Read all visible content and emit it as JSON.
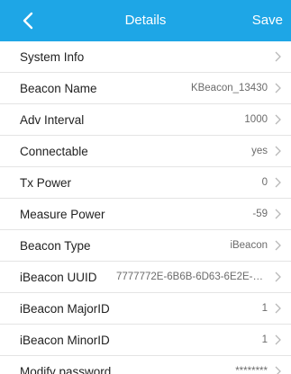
{
  "header": {
    "title": "Details",
    "back_icon": "chevron-left-icon",
    "save_label": "Save",
    "background": "#1ea6e6"
  },
  "rows": [
    {
      "label": "System Info",
      "value": ""
    },
    {
      "label": "Beacon Name",
      "value": "KBeacon_13430"
    },
    {
      "label": "Adv Interval",
      "value": "1000"
    },
    {
      "label": "Connectable",
      "value": "yes"
    },
    {
      "label": "Tx Power",
      "value": "0"
    },
    {
      "label": "Measure Power",
      "value": "-59"
    },
    {
      "label": "Beacon Type",
      "value": "iBeacon"
    },
    {
      "label": "iBeacon UUID",
      "value": "7777772E-6B6B-6D63-6E2E-636F..."
    },
    {
      "label": "iBeacon MajorID",
      "value": "1"
    },
    {
      "label": "iBeacon MinorID",
      "value": "1"
    },
    {
      "label": "Modify password",
      "value": "********"
    }
  ],
  "row_chevron_icon": "chevron-right-icon"
}
